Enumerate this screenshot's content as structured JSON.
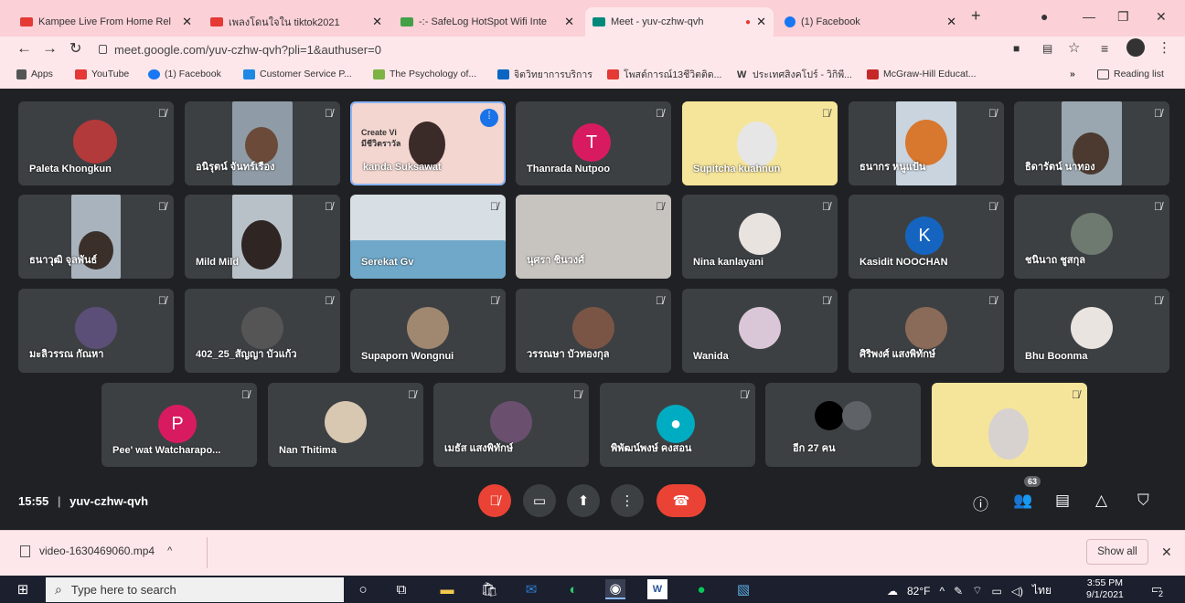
{
  "browser": {
    "tabs": [
      {
        "title": "Kampee Live From Home Rel",
        "favicon_color": "#e53935"
      },
      {
        "title": "เพลงโดนใจใน tiktok2021",
        "favicon_color": "#e53935"
      },
      {
        "title": "-:- SafeLog HotSpot Wifi Inte",
        "favicon_color": "#43a047"
      },
      {
        "title": "Meet - yuv-czhw-qvh",
        "favicon_color": "#00897b"
      },
      {
        "title": "(1) Facebook",
        "favicon_color": "#1877f2"
      }
    ],
    "url": "meet.google.com/yuv-czhw-qvh?pli=1&authuser=0",
    "bookmarks": [
      {
        "label": "Apps",
        "color": "#555"
      },
      {
        "label": "YouTube",
        "color": "#e53935"
      },
      {
        "label": "(1) Facebook",
        "color": "#1877f2"
      },
      {
        "label": "Customer Service P...",
        "color": "#1e88e5"
      },
      {
        "label": "The Psychology of...",
        "color": "#7cb342"
      },
      {
        "label": "จิตวิทยาการบริการ",
        "color": "#0a66c2"
      },
      {
        "label": "โพสต์การณ์13ชีวิตติด...",
        "color": "#e53935"
      },
      {
        "label": "ประเทศสิงคโปร์ - วิกิพี...",
        "color": "#333"
      },
      {
        "label": "McGraw-Hill Educat...",
        "color": "#c62828"
      }
    ],
    "reading_list": "Reading list"
  },
  "meet": {
    "participants": [
      {
        "name": "Paleta Khongkun"
      },
      {
        "name": "อนิรุตน์ จันทร์เรือง"
      },
      {
        "name": "kanda Suksawat"
      },
      {
        "name": "Thanrada Nutpoo",
        "initial": "T",
        "color": "#d81b60"
      },
      {
        "name": "Supitcha kuahnun"
      },
      {
        "name": "ธนากร หนูแป้น"
      },
      {
        "name": "ธิดารัตน์ นาทอง"
      },
      {
        "name": "ธนาวุฒิ จุลพันธ์"
      },
      {
        "name": "Mild Mild"
      },
      {
        "name": "Serekat Gv"
      },
      {
        "name": "นุศรา ชินวงศ์"
      },
      {
        "name": "Nina kanlayani"
      },
      {
        "name": "Kasidit NOOCHAN",
        "initial": "K",
        "color": "#1565c0"
      },
      {
        "name": "ชนินาถ ชูสกุล"
      },
      {
        "name": "มะลิวรรณ กัณหา"
      },
      {
        "name": "402_25_สัญญา บัวแก้ว"
      },
      {
        "name": "Supaporn Wongnui"
      },
      {
        "name": "วรรณษา บัวทองกุล"
      },
      {
        "name": "Wanida"
      },
      {
        "name": "ศิริพงศ์ แสงพิทักษ์"
      },
      {
        "name": "Bhu Boonma"
      },
      {
        "name": "Pee' wat Watcharapo...",
        "initial": "P",
        "color": "#d81b60"
      },
      {
        "name": "Nan Thitima"
      },
      {
        "name": "เมธัส แสงพิทักษ์"
      },
      {
        "name": "พิพัฒน์พงษ์ คงสอน"
      },
      {
        "name": "อีก 27 คน"
      }
    ],
    "presentation_snippet": {
      "line1": "Create Vi",
      "line2": "มีชีวิตราวัล"
    },
    "time": "15:55",
    "code": "yuv-czhw-qvh",
    "people_badge": "63"
  },
  "download": {
    "file": "video-1630469060.mp4",
    "show_all": "Show all"
  },
  "taskbar": {
    "search": "Type here to search",
    "weather": "82°F",
    "lang": "ไทย",
    "time": "3:55 PM",
    "date": "9/1/2021",
    "notif_count": "2"
  },
  "colors": {
    "meet_bg": "#202124",
    "tile_bg": "#3c4043",
    "end_red": "#ea4335"
  }
}
